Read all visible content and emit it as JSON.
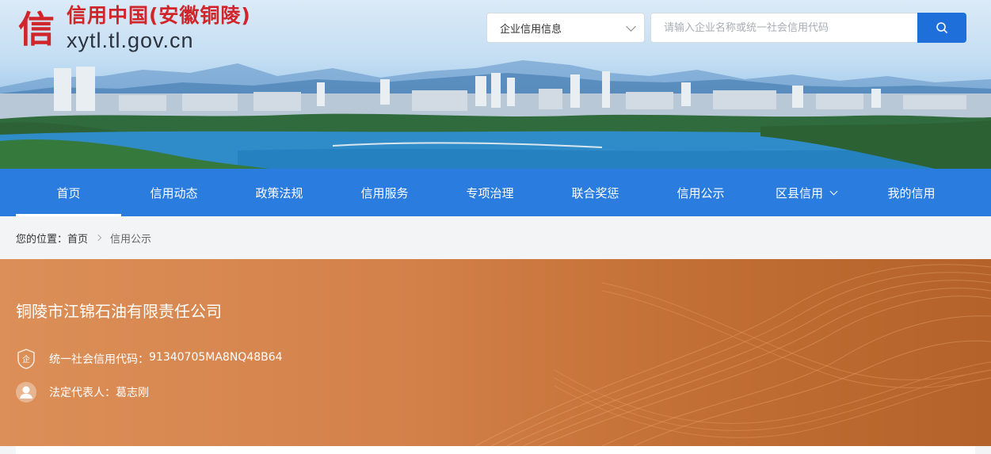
{
  "site": {
    "logo_char": "信",
    "title": "信用中国(安徽铜陵)",
    "url": "xytl.tl.gov.cn"
  },
  "search": {
    "category": "企业信用信息",
    "placeholder": "请输入企业名称或统一社会信用代码",
    "button_icon": "search-icon"
  },
  "nav": {
    "items": [
      {
        "label": "首页",
        "active": true
      },
      {
        "label": "信用动态"
      },
      {
        "label": "政策法规"
      },
      {
        "label": "信用服务"
      },
      {
        "label": "专项治理"
      },
      {
        "label": "联合奖惩"
      },
      {
        "label": "信用公示"
      },
      {
        "label": "区县信用",
        "has_dropdown": true
      },
      {
        "label": "我的信用"
      }
    ]
  },
  "breadcrumb": {
    "prefix": "您的位置：",
    "home": "首页",
    "current": "信用公示"
  },
  "company": {
    "name": "铜陵市江锦石油有限责任公司",
    "code_label": "统一社会信用代码：",
    "code_value": "91340705MA8NQ48B64",
    "rep_label": "法定代表人：",
    "rep_value": "葛志刚"
  },
  "colors": {
    "brand_red": "#d0252b",
    "nav_blue": "#2a7cdf",
    "search_blue": "#1e6fd9",
    "card_orange": "#d4814a"
  }
}
